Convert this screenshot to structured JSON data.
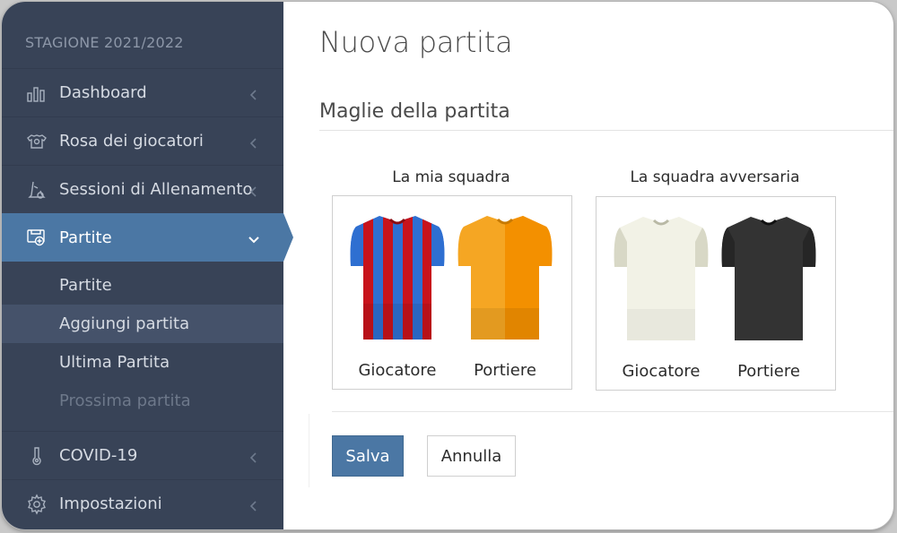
{
  "sidebar": {
    "season": "STAGIONE 2021/2022",
    "items": [
      {
        "label": "Dashboard",
        "icon": "bar-chart-icon"
      },
      {
        "label": "Rosa dei giocatori",
        "icon": "players-icon"
      },
      {
        "label": "Sessioni di Allenamento",
        "icon": "training-icon"
      },
      {
        "label": "Partite",
        "icon": "match-icon"
      },
      {
        "label": "COVID-19",
        "icon": "thermometer-icon"
      },
      {
        "label": "Impostazioni",
        "icon": "gear-icon"
      }
    ],
    "subitems": [
      {
        "label": "Partite"
      },
      {
        "label": "Aggiungi partita"
      },
      {
        "label": "Ultima Partita"
      },
      {
        "label": "Prossima partita"
      }
    ]
  },
  "page": {
    "title": "Nuova partita",
    "section": "Maglie della partita"
  },
  "my_team": {
    "label": "La mia squadra",
    "player_label": "Giocatore",
    "goalkeeper_label": "Portiere"
  },
  "opponent": {
    "label": "La squadra avversaria",
    "player_label": "Giocatore",
    "goalkeeper_label": "Portiere"
  },
  "buttons": {
    "save": "Salva",
    "cancel": "Annulla"
  },
  "colors": {
    "sidebar": "#384357",
    "accent": "#4b77a4",
    "my_player_stripes": [
      "#2e6fd1",
      "#c8131b"
    ],
    "my_goalkeeper": "#f5a623",
    "opp_player": "#f2f2e6",
    "opp_goalkeeper": "#333333"
  }
}
